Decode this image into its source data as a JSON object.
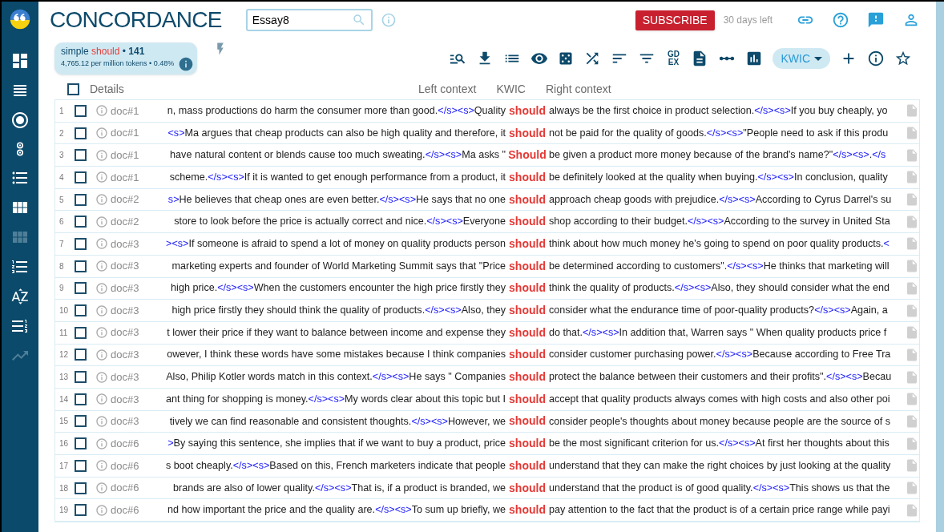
{
  "header": {
    "title": "CONCORDANCE",
    "search": {
      "value": "Essay8"
    },
    "subscribe": "SUBSCRIBE",
    "trial": "30 days left"
  },
  "sidebar": {
    "items": [
      {
        "disabled": false
      },
      {
        "disabled": false
      },
      {
        "disabled": false
      },
      {
        "disabled": false
      },
      {
        "disabled": false
      },
      {
        "disabled": false
      },
      {
        "disabled": true
      },
      {
        "disabled": false
      },
      {
        "disabled": false
      },
      {
        "disabled": false
      },
      {
        "disabled": true
      }
    ]
  },
  "summary": {
    "prefix": "simple",
    "keyword": "should",
    "separator": "•",
    "count": "141",
    "stats": "4,765.12 per million tokens • 0.48%"
  },
  "toolbar": {
    "gdex": [
      "GD",
      "EX"
    ],
    "view": "KWIC"
  },
  "columns": {
    "select_all": {
      "checked": false
    },
    "details": "Details",
    "left": "Left context",
    "kwic": "KWIC",
    "right": "Right context"
  },
  "rows": [
    {
      "num": "1",
      "checked": false,
      "doc": "doc#1",
      "kwic": "should",
      "left": [
        {
          "kind": "text",
          "text": "n, mass productions do harm the consumer more than good."
        },
        {
          "kind": "tag",
          "text": "</s><s>"
        },
        {
          "kind": "text",
          "text": "Quality"
        }
      ],
      "right": [
        {
          "kind": "text",
          "text": "always be the first choice in product selection."
        },
        {
          "kind": "tag",
          "text": "</s><s>"
        },
        {
          "kind": "text",
          "text": "If you buy cheaply, yo"
        }
      ]
    },
    {
      "num": "2",
      "checked": false,
      "doc": "doc#1",
      "kwic": "should",
      "left": [
        {
          "kind": "tag",
          "text": "<s>"
        },
        {
          "kind": "text",
          "text": "Ma argues that cheap products can also be high quality and therefore, it"
        }
      ],
      "right": [
        {
          "kind": "text",
          "text": "not be paid for the quality of goods."
        },
        {
          "kind": "tag",
          "text": "</s><s>"
        },
        {
          "kind": "text",
          "text": "\"People need to ask if this produ"
        }
      ]
    },
    {
      "num": "3",
      "checked": false,
      "doc": "doc#1",
      "kwic": "Should",
      "left": [
        {
          "kind": "text",
          "text": "have natural content or blends cause too much sweating."
        },
        {
          "kind": "tag",
          "text": "</s><s>"
        },
        {
          "kind": "text",
          "text": "Ma asks \""
        }
      ],
      "right": [
        {
          "kind": "text",
          "text": "be given a product more money because of the brand's name?\""
        },
        {
          "kind": "tag",
          "text": "</s><s>"
        },
        {
          "kind": "text",
          "text": "."
        },
        {
          "kind": "tag",
          "text": "</s"
        }
      ]
    },
    {
      "num": "4",
      "checked": false,
      "doc": "doc#1",
      "kwic": "should",
      "left": [
        {
          "kind": "text",
          "text": "scheme."
        },
        {
          "kind": "tag",
          "text": "</s><s>"
        },
        {
          "kind": "text",
          "text": "If it is wanted to get enough performance from a product, it"
        }
      ],
      "right": [
        {
          "kind": "text",
          "text": "be definitely looked at the quality when buying."
        },
        {
          "kind": "tag",
          "text": "</s><s>"
        },
        {
          "kind": "text",
          "text": "In conclusion, quality"
        }
      ]
    },
    {
      "num": "5",
      "checked": false,
      "doc": "doc#2",
      "kwic": "should",
      "left": [
        {
          "kind": "tag",
          "text": "s>"
        },
        {
          "kind": "text",
          "text": "He believes that cheap ones are even better."
        },
        {
          "kind": "tag",
          "text": "</s><s>"
        },
        {
          "kind": "text",
          "text": "He says that no one"
        }
      ],
      "right": [
        {
          "kind": "text",
          "text": "approach cheap goods with prejudice."
        },
        {
          "kind": "tag",
          "text": "</s><s>"
        },
        {
          "kind": "text",
          "text": "According to Cyrus Darrel's su"
        }
      ]
    },
    {
      "num": "6",
      "checked": false,
      "doc": "doc#2",
      "kwic": "should",
      "left": [
        {
          "kind": "text",
          "text": "store to look before the price is actually correct and nice."
        },
        {
          "kind": "tag",
          "text": "</s><s>"
        },
        {
          "kind": "text",
          "text": "Everyone"
        }
      ],
      "right": [
        {
          "kind": "text",
          "text": "shop according to their budget."
        },
        {
          "kind": "tag",
          "text": "</s><s>"
        },
        {
          "kind": "text",
          "text": "According to the survey in United Sta"
        }
      ]
    },
    {
      "num": "7",
      "checked": false,
      "doc": "doc#3",
      "kwic": "should",
      "left": [
        {
          "kind": "tag",
          "text": "><s>"
        },
        {
          "kind": "text",
          "text": "If someone is afraid to spend a lot of money on quality products person"
        }
      ],
      "right": [
        {
          "kind": "text",
          "text": "think about how much money he's going to spend on poor quality products."
        },
        {
          "kind": "tag",
          "text": "<"
        }
      ]
    },
    {
      "num": "8",
      "checked": false,
      "doc": "doc#3",
      "kwic": "should",
      "left": [
        {
          "kind": "text",
          "text": "marketing experts and founder of World Marketing Summit says that \"Price"
        }
      ],
      "right": [
        {
          "kind": "text",
          "text": "be determined according to customers\"."
        },
        {
          "kind": "tag",
          "text": "</s><s>"
        },
        {
          "kind": "text",
          "text": "He thinks that marketing will"
        }
      ]
    },
    {
      "num": "9",
      "checked": false,
      "doc": "doc#3",
      "kwic": "should",
      "left": [
        {
          "kind": "text",
          "text": "high price."
        },
        {
          "kind": "tag",
          "text": "</s><s>"
        },
        {
          "kind": "text",
          "text": "When the customers encounter the high price firstly they"
        }
      ],
      "right": [
        {
          "kind": "text",
          "text": "think the quality of products."
        },
        {
          "kind": "tag",
          "text": "</s><s>"
        },
        {
          "kind": "text",
          "text": "Also, they should consider what the end"
        }
      ]
    },
    {
      "num": "10",
      "checked": false,
      "doc": "doc#3",
      "kwic": "should",
      "left": [
        {
          "kind": "text",
          "text": "high price firstly they should think the quality of products."
        },
        {
          "kind": "tag",
          "text": "</s><s>"
        },
        {
          "kind": "text",
          "text": "Also, they"
        }
      ],
      "right": [
        {
          "kind": "text",
          "text": "consider what the endurance time of poor-quality products?"
        },
        {
          "kind": "tag",
          "text": "</s><s>"
        },
        {
          "kind": "text",
          "text": "Again, a"
        }
      ]
    },
    {
      "num": "11",
      "checked": false,
      "doc": "doc#3",
      "kwic": "should",
      "left": [
        {
          "kind": "text",
          "text": "t lower their price if they want to balance between income and expense they"
        }
      ],
      "right": [
        {
          "kind": "text",
          "text": "do that."
        },
        {
          "kind": "tag",
          "text": "</s><s>"
        },
        {
          "kind": "text",
          "text": "In addition that, Warren says \" When quality products price f"
        }
      ]
    },
    {
      "num": "12",
      "checked": false,
      "doc": "doc#3",
      "kwic": "should",
      "left": [
        {
          "kind": "text",
          "text": "owever, I think these words have some mistakes because I think companies"
        }
      ],
      "right": [
        {
          "kind": "text",
          "text": "consider customer purchasing power."
        },
        {
          "kind": "tag",
          "text": "</s><s>"
        },
        {
          "kind": "text",
          "text": "Because according to Free Tra"
        }
      ]
    },
    {
      "num": "13",
      "checked": false,
      "doc": "doc#3",
      "kwic": "should",
      "left": [
        {
          "kind": "text",
          "text": "Also, Philip Kotler words match in this context."
        },
        {
          "kind": "tag",
          "text": "</s><s>"
        },
        {
          "kind": "text",
          "text": "He says \" Companies"
        }
      ],
      "right": [
        {
          "kind": "text",
          "text": "protect the balance between their customers and their profits\"."
        },
        {
          "kind": "tag",
          "text": "</s><s>"
        },
        {
          "kind": "text",
          "text": "Becau"
        }
      ]
    },
    {
      "num": "14",
      "checked": false,
      "doc": "doc#3",
      "kwic": "should",
      "left": [
        {
          "kind": "text",
          "text": "ant thing for shopping is money."
        },
        {
          "kind": "tag",
          "text": "</s><s>"
        },
        {
          "kind": "text",
          "text": "My words clear about this topic but I"
        }
      ],
      "right": [
        {
          "kind": "text",
          "text": "accept that quality products always comes with high costs and also other poi"
        }
      ]
    },
    {
      "num": "15",
      "checked": false,
      "doc": "doc#3",
      "kwic": "should",
      "left": [
        {
          "kind": "text",
          "text": "tively we can find reasonable and consistent thoughts."
        },
        {
          "kind": "tag",
          "text": "</s><s>"
        },
        {
          "kind": "text",
          "text": "However, we"
        }
      ],
      "right": [
        {
          "kind": "text",
          "text": "consider people's thoughts about money because people are the source of s"
        }
      ]
    },
    {
      "num": "16",
      "checked": false,
      "doc": "doc#6",
      "kwic": "should",
      "left": [
        {
          "kind": "tag",
          "text": ">"
        },
        {
          "kind": "text",
          "text": "By saying this sentence, she implies that if we want to buy a product, price"
        }
      ],
      "right": [
        {
          "kind": "text",
          "text": "be the most significant criterion for us."
        },
        {
          "kind": "tag",
          "text": "</s><s>"
        },
        {
          "kind": "text",
          "text": "At first her thoughts about this"
        }
      ]
    },
    {
      "num": "17",
      "checked": false,
      "doc": "doc#6",
      "kwic": "should",
      "left": [
        {
          "kind": "text",
          "text": "s boot cheaply."
        },
        {
          "kind": "tag",
          "text": "</s><s>"
        },
        {
          "kind": "text",
          "text": "Based on this, French marketers indicate that people"
        }
      ],
      "right": [
        {
          "kind": "text",
          "text": "understand that they can make the right choices by just looking at the quality"
        }
      ]
    },
    {
      "num": "18",
      "checked": false,
      "doc": "doc#6",
      "kwic": "should",
      "left": [
        {
          "kind": "text",
          "text": "brands are also of lower quality."
        },
        {
          "kind": "tag",
          "text": "</s><s>"
        },
        {
          "kind": "text",
          "text": "That is, if a product is branded, we"
        }
      ],
      "right": [
        {
          "kind": "text",
          "text": "understand that the product is of good quality."
        },
        {
          "kind": "tag",
          "text": "</s><s>"
        },
        {
          "kind": "text",
          "text": "This shows us that the"
        }
      ]
    },
    {
      "num": "19",
      "checked": false,
      "doc": "doc#6",
      "kwic": "should",
      "left": [
        {
          "kind": "text",
          "text": "nd how important the price and the quality are."
        },
        {
          "kind": "tag",
          "text": "</s><s>"
        },
        {
          "kind": "text",
          "text": "To sum up briefly, we"
        }
      ],
      "right": [
        {
          "kind": "text",
          "text": "pay attention to the fact that the product is of a certain price range while payi"
        }
      ]
    }
  ]
}
